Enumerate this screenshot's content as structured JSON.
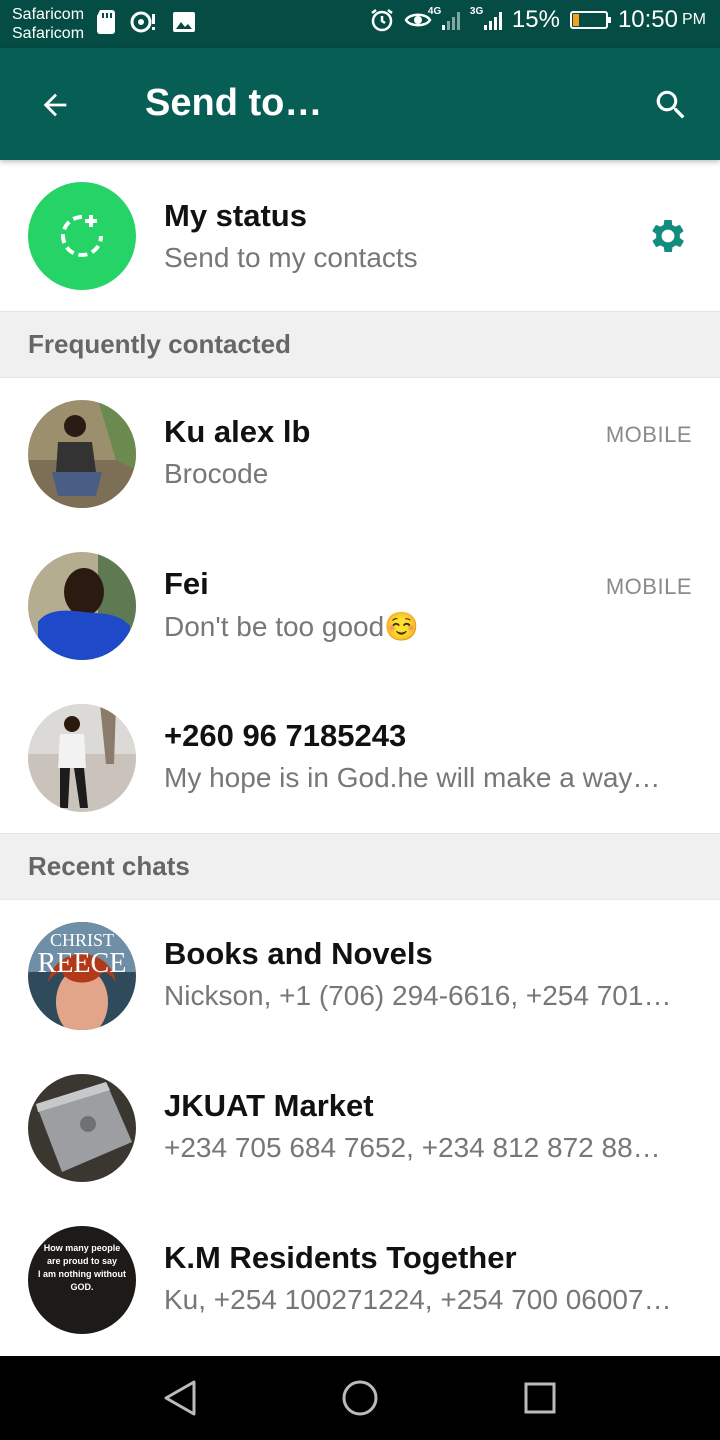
{
  "status_bar": {
    "carrier1": "Safaricom",
    "carrier2": "Safaricom",
    "battery": "15%",
    "battery_level": 0.15,
    "time": "10:50",
    "ampm": "PM",
    "network1": "4G",
    "network2": "3G"
  },
  "app_bar": {
    "title": "Send to…",
    "back_icon": "arrow-left-icon",
    "search_icon": "search-icon"
  },
  "my_status": {
    "title": "My status",
    "subtitle": "Send to my contacts"
  },
  "sections": {
    "frequent": "Frequently contacted",
    "recent": "Recent chats"
  },
  "frequent_contacts": [
    {
      "name": "Ku alex lb",
      "status": "Brocode",
      "tag": "MOBILE"
    },
    {
      "name": "Fei",
      "status": "Don't be too good☺️",
      "tag": "MOBILE"
    },
    {
      "name": "+260 96 7185243",
      "status": "My hope is in God.he will make a way…",
      "tag": ""
    }
  ],
  "recent_chats": [
    {
      "name": "Books and Novels",
      "members": "Nickson, +1 (706) 294-6616, +254 701…",
      "avatar_text_1": "CHRIST",
      "avatar_text_2": "REECE"
    },
    {
      "name": "JKUAT Market",
      "members": "+234 705 684 7652, +234 812 872 88…"
    },
    {
      "name": "K.M Residents Together",
      "members": "Ku, +254 100271224, +254 700 06007…",
      "avatar_text_1": "How many people are proud to say",
      "avatar_text_2": "I am nothing without GOD."
    }
  ],
  "colors": {
    "status_bar": "#054d44",
    "app_bar": "#075e54",
    "status_green": "#25d366",
    "gear": "#128c7e"
  }
}
